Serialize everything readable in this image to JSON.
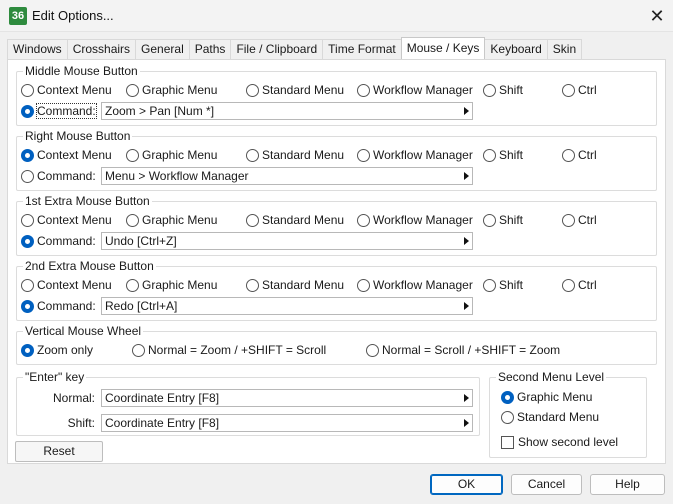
{
  "window": {
    "title": "Edit Options...",
    "icon_text": "36"
  },
  "tabs": [
    "Windows",
    "Crosshairs",
    "General",
    "Paths",
    "File / Clipboard",
    "Time Format",
    "Mouse / Keys",
    "Keyboard",
    "Skin"
  ],
  "active_tab": "Mouse / Keys",
  "radio_labels": {
    "context": "Context Menu",
    "graphic": "Graphic Menu",
    "standard": "Standard Menu",
    "workflow": "Workflow Manager",
    "shift": "Shift",
    "ctrl": "Ctrl",
    "command": "Command:"
  },
  "groups": {
    "middle": {
      "title": "Middle Mouse Button",
      "selected": "command",
      "command_value": "Zoom > Pan [Num *]"
    },
    "right": {
      "title": "Right Mouse Button",
      "selected": "context",
      "command_value": "Menu > Workflow Manager"
    },
    "extra1": {
      "title": "1st Extra Mouse Button",
      "selected": "command",
      "command_value": "Undo [Ctrl+Z]"
    },
    "extra2": {
      "title": "2nd Extra Mouse Button",
      "selected": "command",
      "command_value": "Redo [Ctrl+A]"
    }
  },
  "wheel": {
    "title": "Vertical Mouse Wheel",
    "options": [
      "Zoom only",
      "Normal = Zoom / +SHIFT = Scroll",
      "Normal = Scroll / +SHIFT = Zoom"
    ],
    "selected": 0
  },
  "enter_key": {
    "title": "\"Enter\" key",
    "normal_label": "Normal:",
    "normal_value": "Coordinate Entry [F8]",
    "shift_label": "Shift:",
    "shift_value": "Coordinate Entry [F8]"
  },
  "second_menu": {
    "title": "Second Menu Level",
    "options": [
      "Graphic Menu",
      "Standard Menu"
    ],
    "selected": 0,
    "checkbox_label": "Show second level",
    "checked": false
  },
  "buttons": {
    "reset": "Reset",
    "ok": "OK",
    "cancel": "Cancel",
    "help": "Help"
  },
  "colors": {
    "accent": "#0060c0",
    "app_icon": "#2e8b3e"
  }
}
